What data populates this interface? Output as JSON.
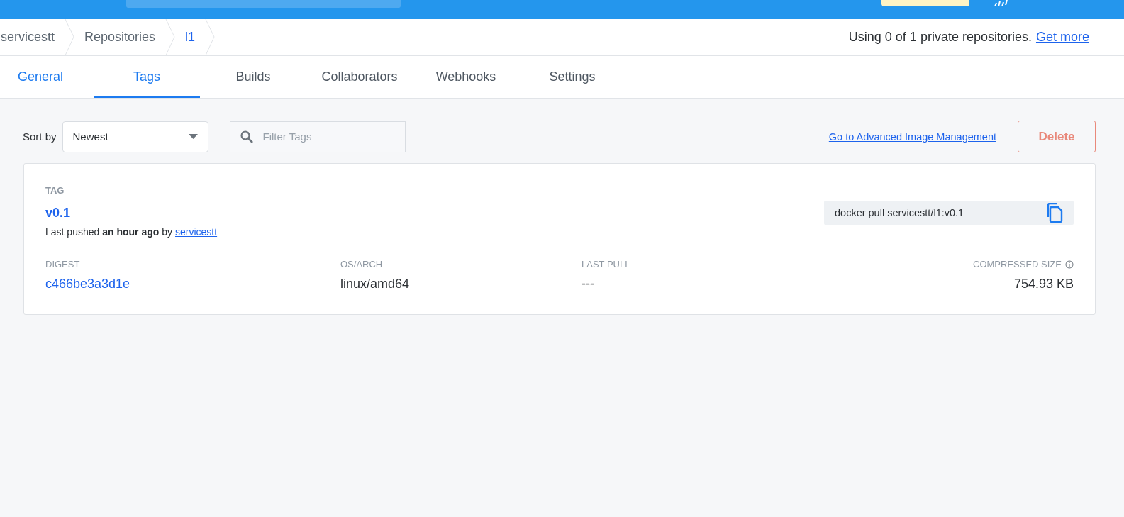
{
  "breadcrumb": [
    {
      "label": "servicestt",
      "current": false
    },
    {
      "label": "Repositories",
      "current": false
    },
    {
      "label": "l1",
      "current": true
    }
  ],
  "usage": {
    "text": "Using 0 of 1 private repositories.",
    "link": "Get more"
  },
  "tabs": [
    {
      "label": "General",
      "selected": false,
      "hovered": true
    },
    {
      "label": "Tags",
      "selected": true,
      "hovered": false
    },
    {
      "label": "Builds",
      "selected": false,
      "hovered": false
    },
    {
      "label": "Collaborators",
      "selected": false,
      "hovered": false
    },
    {
      "label": "Webhooks",
      "selected": false,
      "hovered": false
    },
    {
      "label": "Settings",
      "selected": false,
      "hovered": false
    }
  ],
  "toolbar": {
    "sort_label": "Sort by",
    "sort_value": "Newest",
    "filter_placeholder": "Filter Tags",
    "advanced_link": "Go to Advanced Image Management",
    "delete_button": "Delete"
  },
  "tag_card": {
    "heading": "TAG",
    "tag": "v0.1",
    "pushed": "Last pushed **an hour ago** by",
    "pushed_by": "servicestt",
    "pull_command": "docker pull servicestt/l1:v0.1",
    "columns": [
      {
        "label": "DIGEST",
        "value": "c466be3a3d1e",
        "kind": "link"
      },
      {
        "label": "OS/ARCH",
        "value": "linux/amd64",
        "kind": "text"
      },
      {
        "label": "LAST PULL",
        "value": "---",
        "kind": "text"
      },
      {
        "label": "COMPRESSED SIZE",
        "value": "754.93 KB",
        "kind": "size"
      }
    ]
  }
}
